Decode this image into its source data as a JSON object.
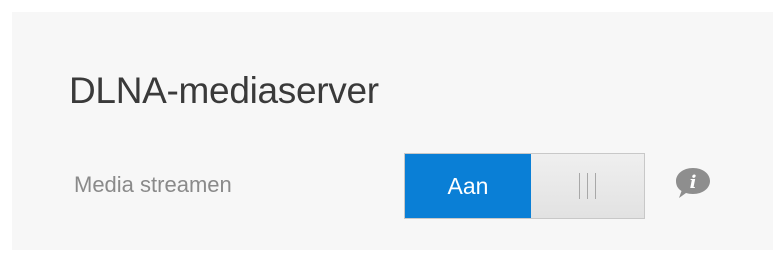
{
  "section": {
    "title": "DLNA-mediaserver"
  },
  "setting": {
    "label": "Media streamen",
    "toggle": {
      "state_label": "Aan",
      "is_on": true,
      "on_color": "#0a7fd6"
    },
    "info_icon": "info-icon"
  }
}
